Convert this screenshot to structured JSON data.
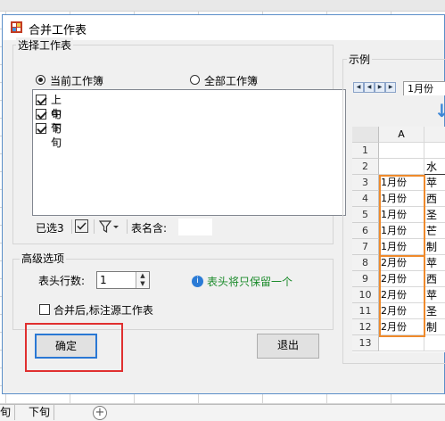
{
  "dialog": {
    "title": "合并工作表",
    "select_group": {
      "legend": "选择工作表",
      "radio_current": "当前工作簿",
      "radio_all": "全部工作簿",
      "selected_radio": "当前工作簿",
      "sheets": [
        {
          "label": "上旬",
          "checked": true
        },
        {
          "label": "中旬",
          "checked": true
        },
        {
          "label": "下旬",
          "checked": true
        }
      ],
      "selected_count": "已选3",
      "name_contains_label": "表名含:",
      "name_contains_value": ""
    },
    "advanced": {
      "legend": "高级选项",
      "header_rows_label": "表头行数:",
      "header_rows_value": "1",
      "hint": "表头将只保留一个",
      "mark_source_label": "合并后,标注源工作表",
      "mark_source_checked": false
    },
    "buttons": {
      "ok": "确定",
      "exit": "退出"
    },
    "example": {
      "legend": "示例",
      "sheet_tab": "1月份",
      "col_a": "A",
      "rows": [
        {
          "num": "1",
          "a": "",
          "b": ""
        },
        {
          "num": "2",
          "a": "",
          "b": "水"
        },
        {
          "num": "3",
          "a": "1月份",
          "b": "苹"
        },
        {
          "num": "4",
          "a": "1月份",
          "b": "西"
        },
        {
          "num": "5",
          "a": "1月份",
          "b": "圣"
        },
        {
          "num": "6",
          "a": "1月份",
          "b": "芒"
        },
        {
          "num": "7",
          "a": "1月份",
          "b": "制"
        },
        {
          "num": "8",
          "a": "2月份",
          "b": "苹"
        },
        {
          "num": "9",
          "a": "2月份",
          "b": "西"
        },
        {
          "num": "10",
          "a": "2月份",
          "b": "苹"
        },
        {
          "num": "11",
          "a": "2月份",
          "b": "圣"
        },
        {
          "num": "12",
          "a": "2月份",
          "b": "制"
        },
        {
          "num": "13",
          "a": "",
          "b": ""
        }
      ]
    }
  },
  "sheet_tabs": [
    "旬",
    "下旬"
  ],
  "colors": {
    "ok_highlight": "#e03030",
    "example_highlight": "#ef8a2b",
    "hint": "#1a8a2a",
    "focus_border": "#2a78d4"
  }
}
